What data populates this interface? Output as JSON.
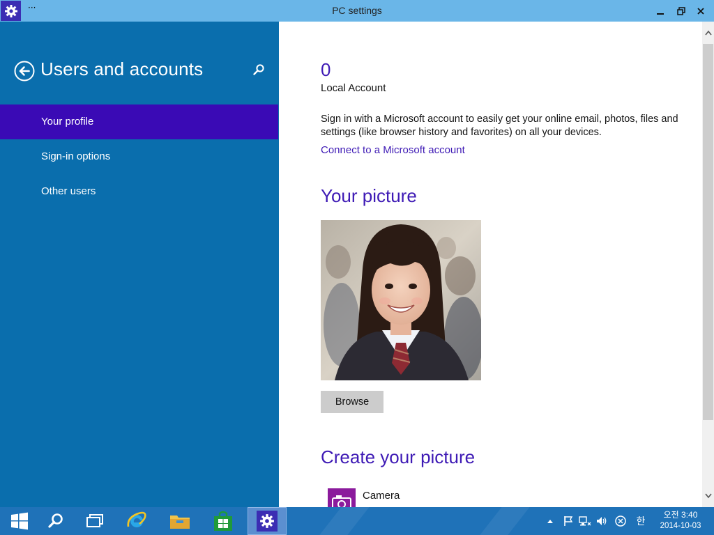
{
  "window": {
    "title": "PC settings",
    "menu_label": "···"
  },
  "sidebar": {
    "title": "Users and accounts",
    "items": [
      {
        "label": "Your profile",
        "active": true
      },
      {
        "label": "Sign-in options",
        "active": false
      },
      {
        "label": "Other users",
        "active": false
      }
    ]
  },
  "profile": {
    "account_name": "0",
    "account_type": "Local Account",
    "description": "Sign in with a Microsoft account to easily get your online email, photos, files and settings (like browser history and favorites) on all your devices.",
    "connect_link": "Connect to a Microsoft account",
    "your_picture_heading": "Your picture",
    "browse_label": "Browse",
    "create_picture_heading": "Create your picture",
    "camera_label": "Camera"
  },
  "taskbar": {
    "icons": [
      "windows-start-icon",
      "search-icon",
      "task-view-icon",
      "internet-explorer-icon",
      "file-explorer-icon",
      "store-icon",
      "settings-icon"
    ],
    "ime": "한",
    "time": "오전 3:40",
    "date": "2014-10-03"
  },
  "colors": {
    "titlebar": "#6ab6e8",
    "sidebar": "#0a6ead",
    "sidebar_active": "#3a0ab5",
    "accent_text": "#3e1ab5",
    "taskbar": "#1f72b8"
  }
}
